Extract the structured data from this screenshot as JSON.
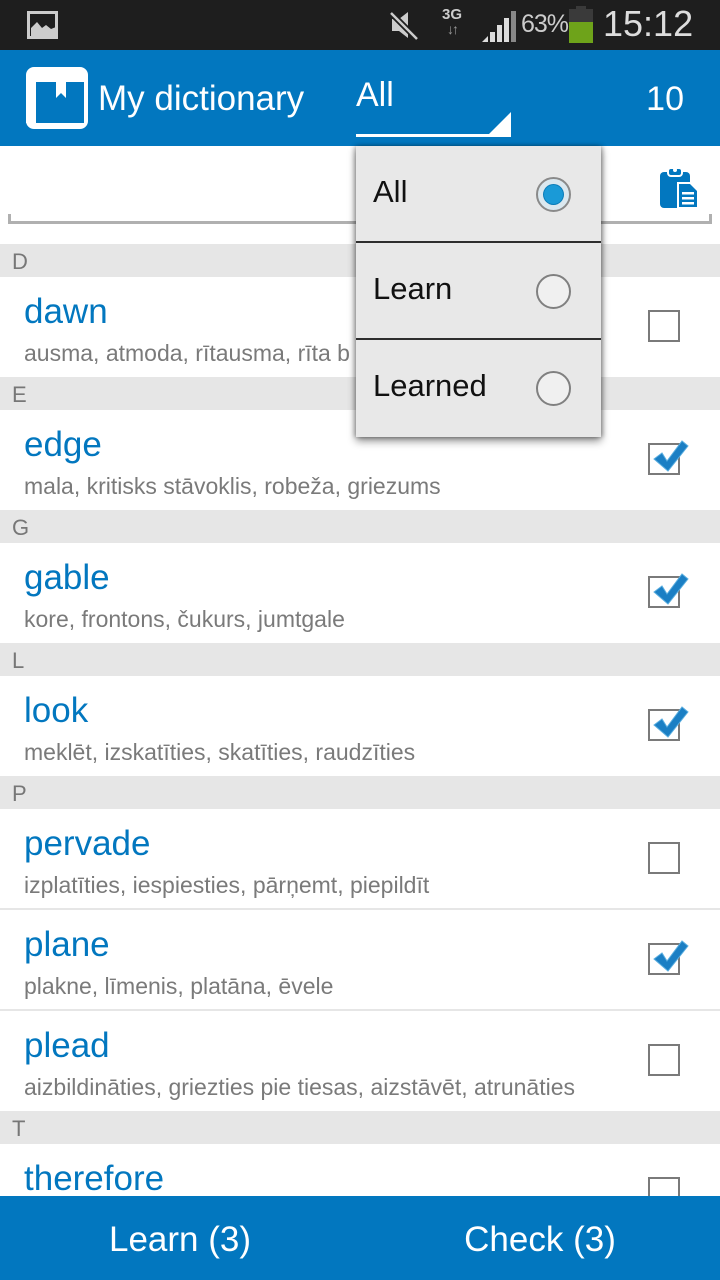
{
  "status_bar": {
    "notification_icon": "gallery-icon",
    "mute_icon": "mute-icon",
    "network_type": "3G",
    "network_arrows": "↓↑",
    "signal_icon": "signal-icon",
    "battery_percent": "63%",
    "battery_level": 0.63,
    "time": "15:12"
  },
  "action_bar": {
    "logo_icon": "dictionary-book-icon",
    "title": "My dictionary",
    "filter_value": "All",
    "word_count": "10"
  },
  "search": {
    "value": "",
    "placeholder": "",
    "paste_icon": "clipboard-icon"
  },
  "filter_dropdown": {
    "options": [
      {
        "label": "All",
        "selected": true
      },
      {
        "label": "Learn",
        "selected": false
      },
      {
        "label": "Learned",
        "selected": false
      }
    ]
  },
  "sections": [
    {
      "letter": "D",
      "words": [
        {
          "word": "dawn",
          "translation": "ausma, atmoda, rītausma, rīta b",
          "checked": false
        }
      ]
    },
    {
      "letter": "E",
      "words": [
        {
          "word": "edge",
          "translation": "mala, kritisks stāvoklis, robeža, griezums",
          "checked": true
        }
      ]
    },
    {
      "letter": "G",
      "words": [
        {
          "word": "gable",
          "translation": "kore, frontons, čukurs, jumtgale",
          "checked": true
        }
      ]
    },
    {
      "letter": "L",
      "words": [
        {
          "word": "look",
          "translation": "meklēt, izskatīties, skatīties, raudzīties",
          "checked": true
        }
      ]
    },
    {
      "letter": "P",
      "words": [
        {
          "word": "pervade",
          "translation": "izplatīties, iespiesties, pārņemt, piepildīt",
          "checked": false
        },
        {
          "word": "plane",
          "translation": "plakne, līmenis, platāna, ēvele",
          "checked": true
        },
        {
          "word": "plead",
          "translation": "aizbildināties, griezties pie tiesas, aizstāvēt, atrunāties",
          "checked": false
        }
      ]
    },
    {
      "letter": "T",
      "words": [
        {
          "word": "therefore",
          "translation": "",
          "checked": false
        }
      ]
    }
  ],
  "bottom_bar": {
    "learn_label": "Learn (3)",
    "check_label": "Check (3)"
  },
  "colors": {
    "primary": "#0277bf",
    "status_bar": "#1e1e1e",
    "section_header": "#e6e6e6",
    "battery": "#6ea31a",
    "radio_selected": "#1a9ad7"
  }
}
